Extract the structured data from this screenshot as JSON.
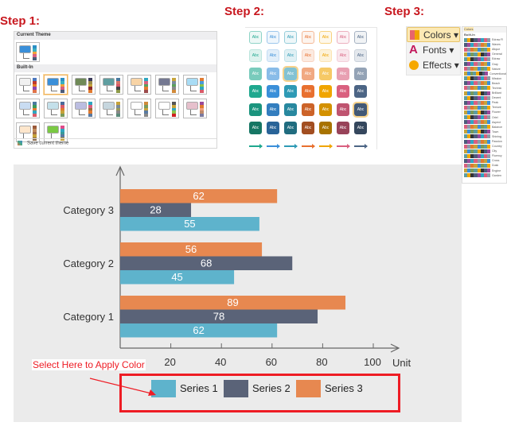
{
  "steps": {
    "step1": "Step 1:",
    "step2": "Step 2:",
    "step3": "Step 3:"
  },
  "theme_panel": {
    "current_label": "Current Theme",
    "builtin_label": "Built-In",
    "save_label": "Save current theme",
    "themes": [
      {
        "box": "#3a8fd9",
        "bars": [
          "#2b8fc4",
          "#3ab0c0",
          "#f2a33a",
          "#d9607f",
          "#4c5c7a"
        ],
        "selected": false
      },
      {
        "box": "#f1f1f1",
        "bars": [
          "#4b77be",
          "#c0392b",
          "#e67e22",
          "#8e44ad",
          "#e0734a"
        ],
        "selected": false
      },
      {
        "box": "#3a8fd9",
        "bars": [
          "#2b8fc4",
          "#3ab0c0",
          "#f2a33a",
          "#d9607f",
          "#4c5c7a"
        ],
        "selected": true
      },
      {
        "box": "#6f8a57",
        "bars": [
          "#3b3b5a",
          "#9b8b4a",
          "#c6a33a",
          "#8b2a2a",
          "#e07a30"
        ],
        "selected": false
      },
      {
        "box": "#5f9ea0",
        "bars": [
          "#4a7aa0",
          "#d9776a",
          "#d95b6a",
          "#444",
          "#8e9a4a"
        ],
        "selected": false
      },
      {
        "box": "#f8d4a6",
        "bars": [
          "#2ea6c0",
          "#d9607f",
          "#5aa05a",
          "#e07a30",
          "#9b4a4a"
        ],
        "selected": false
      },
      {
        "box": "#747891",
        "bars": [
          "#c6a33a",
          "#7a8a9a",
          "#5aa05a",
          "#888",
          "#d08a3a"
        ],
        "selected": false
      },
      {
        "box": "#a8dcf5",
        "bars": [
          "#e07a30",
          "#4a9ad9",
          "#8bc34a",
          "#2ea6c0",
          "#d95b6a"
        ],
        "selected": false
      },
      {
        "box": "#c9dcf2",
        "bars": [
          "#4a7aa0",
          "#3a9a5a",
          "#e07a30",
          "#2ea6c0",
          "#d95b6a"
        ],
        "selected": false
      },
      {
        "box": "#c4e0ea",
        "bars": [
          "#4a6a9a",
          "#d95b6a",
          "#e07a30",
          "#c6a33a",
          "#7a9a5a"
        ],
        "selected": false
      },
      {
        "box": "#bbbde0",
        "bars": [
          "#2ea6c0",
          "#d9607f",
          "#9a6a3a",
          "#e07a30",
          "#5a7aa0"
        ],
        "selected": false
      },
      {
        "box": "#c6d6de",
        "bars": [
          "#c6a33a",
          "#7a8a9a",
          "#9a9a5a",
          "#888",
          "#5a8a7a"
        ],
        "selected": false
      },
      {
        "box": "#ffffff",
        "bars": [
          "#d08a3a",
          "#7a9a5a",
          "#c6a33a",
          "#5a7aa0",
          "#888"
        ],
        "selected": false
      },
      {
        "box": "#ffffff",
        "bars": [
          "#555",
          "#c6a33a",
          "#2ea6c0",
          "#8bc34a",
          "#d02020"
        ],
        "selected": false
      },
      {
        "box": "#e6c0cc",
        "bars": [
          "#9a4a9a",
          "#e07a30",
          "#f0a080",
          "#c08a6a",
          "#7a7aa0"
        ],
        "selected": false
      },
      {
        "box": "#fde6cc",
        "bars": [
          "#9a5a3a",
          "#c08a5a",
          "#a06a4a",
          "#c6a33a",
          "#8a6a4a"
        ],
        "selected": false
      },
      {
        "box": "#7ac943",
        "bars": [
          "#e04a8a",
          "#2ea6c0",
          "#3a9a9a",
          "#5a7aa0",
          "#c6a33a"
        ],
        "selected": false
      }
    ]
  },
  "style_panel": {
    "abc": "Abc",
    "columns": [
      "#1fa88f",
      "#3a8fd9",
      "#2e9ab5",
      "#e8702f",
      "#f0a500",
      "#d9607f",
      "#4c6585"
    ],
    "highlight": [
      [
        2,
        2
      ],
      [
        4,
        6
      ]
    ]
  },
  "ribbon": {
    "colors": "Colors",
    "fonts": "Fonts",
    "effects": "Effects",
    "colors_small": "Colors",
    "builtin": "Built-In"
  },
  "color_schemes": [
    "Edraw Fl",
    "Waves",
    "Atique",
    "General",
    "Edraw",
    "Gray",
    "Nature",
    "Conventional",
    "Mission",
    "Beach",
    "Technic",
    "Brilliant",
    "Decent",
    "Peak",
    "Texture",
    "Flower",
    "Oriel",
    "Aspect",
    "Balance",
    "Town",
    "Shining",
    "Passion",
    "Country",
    "City",
    "Fluency",
    "Cross",
    "Dusk",
    "Engine",
    "Garden"
  ],
  "swatch_colors": [
    "#5f9ea0",
    "#2ea6c0",
    "#3a8fd9",
    "#4c5c7a",
    "#e07a30",
    "#f0a500",
    "#d9607f",
    "#7a9a5a",
    "#9a4a9a",
    "#c6a33a",
    "#333333",
    "#8e9aa6"
  ],
  "callout": "Select Here to Apply Color",
  "chart_data": {
    "type": "bar",
    "orientation": "horizontal",
    "categories": [
      "Category 1",
      "Category 2",
      "Category 3"
    ],
    "series": [
      {
        "name": "Series 1",
        "color": "#5eb3cc",
        "values": [
          62,
          45,
          55
        ]
      },
      {
        "name": "Series 2",
        "color": "#5a6378",
        "values": [
          78,
          68,
          28
        ]
      },
      {
        "name": "Series 3",
        "color": "#e78850",
        "values": [
          89,
          56,
          62
        ]
      }
    ],
    "xticks": [
      20,
      40,
      60,
      80,
      100
    ],
    "xlabel": "Unit",
    "xlim": [
      0,
      100
    ],
    "grid": false,
    "legend": "bottom",
    "data_labels": true
  }
}
